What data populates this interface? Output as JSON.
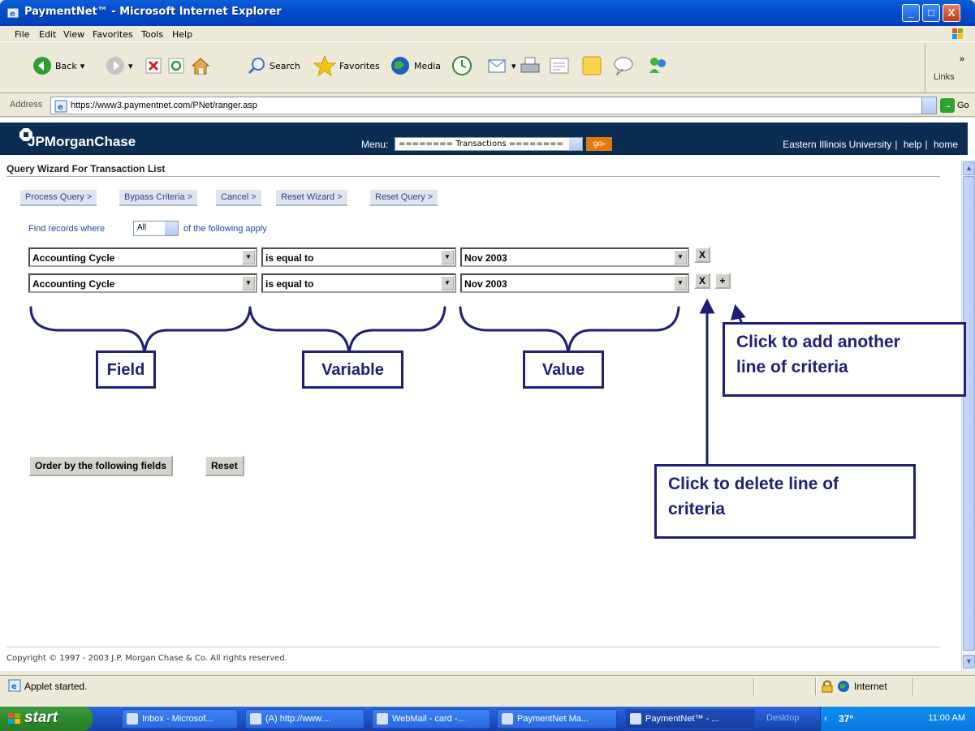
{
  "window": {
    "title": "PaymentNet™ - Microsoft Internet Explorer",
    "minimize": "_",
    "maximize": "□",
    "close": "X"
  },
  "menubar": [
    "File",
    "Edit",
    "View",
    "Favorites",
    "Tools",
    "Help"
  ],
  "toolbar": {
    "back": "Back",
    "search": "Search",
    "favorites": "Favorites",
    "media": "Media",
    "links": "Links"
  },
  "address": {
    "label": "Address",
    "url": "https://www3.paymentnet.com/PNet/ranger.asp",
    "go": "Go"
  },
  "header": {
    "logo": "JPMorganChase",
    "menu_label": "Menu:",
    "menu_value": "======== Transactions ========",
    "go": "go›",
    "org": "Eastern Illinois University",
    "help": "help",
    "home": "home",
    "sep": "|"
  },
  "query": {
    "title": "Query Wizard For Transaction List",
    "actions": [
      "Process Query >",
      "Bypass Criteria >",
      "Cancel >",
      "Reset Wizard >",
      "Reset Query >"
    ],
    "find_label": "Find records where",
    "find_value": "All",
    "find_label2": "of the following apply",
    "rows": [
      {
        "field": "Accounting Cycle",
        "variable": "is equal to",
        "value": "Nov 2003"
      },
      {
        "field": "Accounting Cycle",
        "variable": "is equal to",
        "value": "Nov 2003"
      }
    ],
    "delete_label": "X",
    "add_label": "+",
    "order_button": "Order by the following fields",
    "reset_button": "Reset"
  },
  "callouts": {
    "field": "Field",
    "variable": "Variable",
    "value": "Value",
    "add_line1": "Click to add another",
    "add_line2": "line of criteria",
    "delete_line1": "Click to delete line of",
    "delete_line2": "criteria"
  },
  "footer": {
    "copyright": "Copyright © 1997 - 2003 J.P. Morgan Chase & Co. All rights reserved."
  },
  "statusbar": {
    "text": "Applet started.",
    "zone": "Internet"
  },
  "taskbar": {
    "start": "start",
    "tasks": [
      "Inbox - Microsof...",
      "(A) http://www....",
      "WebMail - card -...",
      "PaymentNet Ma...",
      "PaymentNet™ - ..."
    ],
    "desktop": "Desktop",
    "temp": "37°",
    "time": "11:00 AM"
  },
  "colors": {
    "header_bg": "#0b2d52",
    "callout_border": "#1f1f7a",
    "link_text": "#1b4ca0",
    "go_orange": "#e07b12"
  }
}
